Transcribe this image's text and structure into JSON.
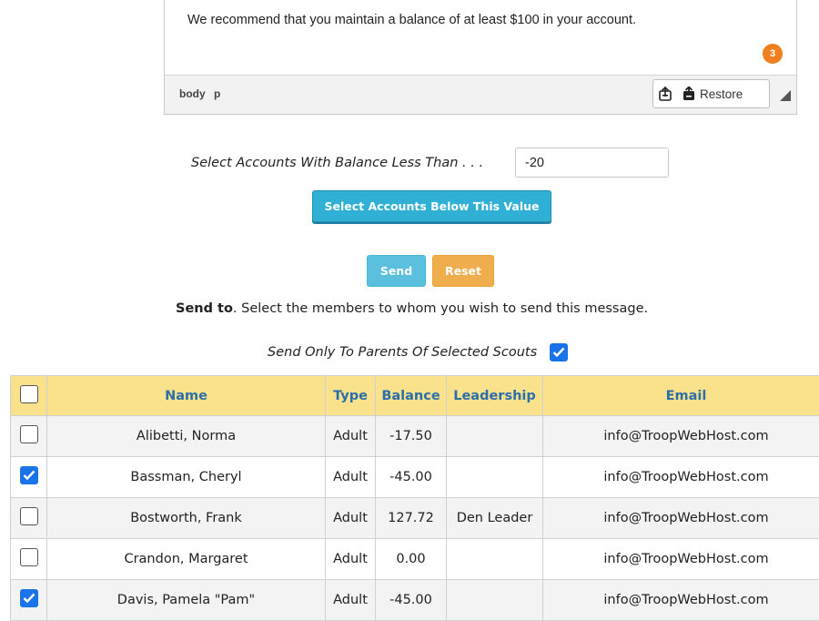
{
  "editor": {
    "content": "We recommend that you maintain a balance of at least $100 in your account.",
    "badge_count": "3",
    "path_items": [
      "body",
      "p"
    ],
    "restore_label": "Restore"
  },
  "select_accounts": {
    "label": "Select Accounts With Balance Less Than . . .",
    "input_value": "-20",
    "button_label": "Select Accounts Below This Value"
  },
  "actions": {
    "send_label": "Send",
    "reset_label": "Reset"
  },
  "send_to": {
    "bold": "Send to",
    "text": ".  Select the members to whom you wish to send this message."
  },
  "parents_only": {
    "label": "Send Only To Parents Of Selected Scouts",
    "checked": true
  },
  "table": {
    "columns": [
      "Name",
      "Type",
      "Balance",
      "Leadership",
      "Email"
    ],
    "rows": [
      {
        "checked": false,
        "name": "Alibetti, Norma",
        "type": "Adult",
        "balance": "-17.50",
        "leadership": "",
        "email": "info@TroopWebHost.com"
      },
      {
        "checked": true,
        "name": "Bassman, Cheryl",
        "type": "Adult",
        "balance": "-45.00",
        "leadership": "",
        "email": "info@TroopWebHost.com"
      },
      {
        "checked": false,
        "name": "Bostworth, Frank",
        "type": "Adult",
        "balance": "127.72",
        "leadership": "Den Leader",
        "email": "info@TroopWebHost.com"
      },
      {
        "checked": false,
        "name": "Crandon, Margaret",
        "type": "Adult",
        "balance": "0.00",
        "leadership": "",
        "email": "info@TroopWebHost.com"
      },
      {
        "checked": true,
        "name": "Davis, Pamela \"Pam\"",
        "type": "Adult",
        "balance": "-45.00",
        "leadership": "",
        "email": "info@TroopWebHost.com"
      }
    ]
  },
  "colors": {
    "header_bg": "#f9e28b",
    "header_text": "#2c6fa8",
    "checkbox_on": "#1a73e8",
    "badge": "#f0801e",
    "primary_button": "#31b0d5",
    "send_button": "#5bc0de",
    "reset_button": "#f0ad4e"
  }
}
